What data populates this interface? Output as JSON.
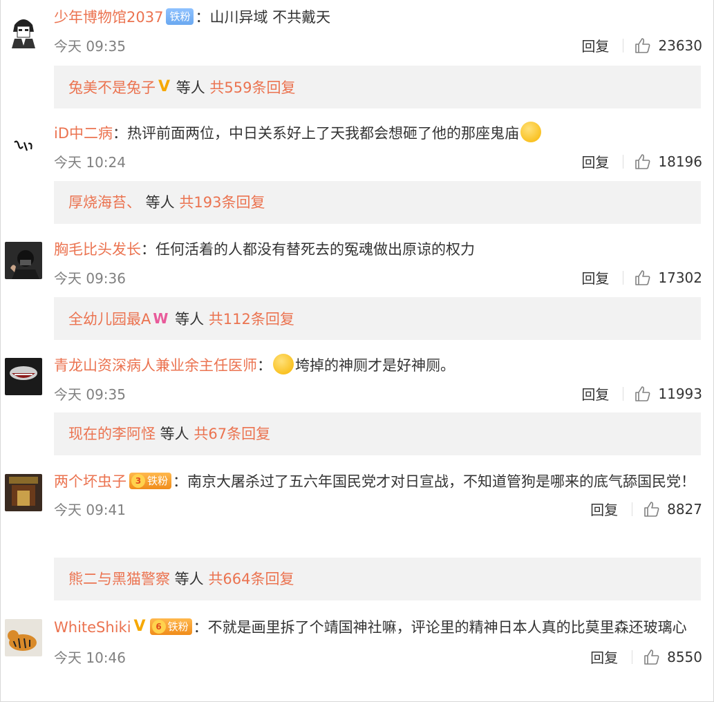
{
  "comments": [
    {
      "username": "少年博物馆2037",
      "badge_text": "铁粉",
      "text": "：山川异域 不共戴天",
      "time": "今天 09:35",
      "reply_label": "回复",
      "likes": "23630",
      "sub_user": "兔美不是兔子",
      "sub_mid": " 等人 ",
      "sub_count": "共559条回复"
    },
    {
      "username": "iD中二病",
      "text": "：热评前面两位，中日关系好上了天我都会想砸了他的那座鬼庙",
      "time": "今天 10:24",
      "reply_label": "回复",
      "likes": "18196",
      "sub_user": "厚烧海苔、",
      "sub_mid": " 等人 ",
      "sub_count": "共193条回复"
    },
    {
      "username": "胸毛比头发长",
      "text": "：任何活着的人都没有替死去的冤魂做出原谅的权力",
      "time": "今天 09:36",
      "reply_label": "回复",
      "likes": "17302",
      "sub_user": "全幼儿园最A",
      "sub_mid": " 等人 ",
      "sub_count": "共112条回复"
    },
    {
      "username": "青龙山资深病人兼业余主任医师",
      "text_pre": "：",
      "text": "垮掉的神厕才是好神厕。",
      "time": "今天 09:35",
      "reply_label": "回复",
      "likes": "11993",
      "sub_user": "现在的李阿怪",
      "sub_mid": " 等人 ",
      "sub_count": "共67条回复"
    },
    {
      "username": "两个坏虫子",
      "badge_level": "3",
      "badge_text": "铁粉",
      "text": "：南京大屠杀过了五六年国民党才对日宣战，不知道管狗是哪来的底气舔国民党！",
      "time": "今天 09:41",
      "reply_label": "回复",
      "likes": "8827",
      "sub_user": "熊二与黑猫警察",
      "sub_mid": " 等人 ",
      "sub_count": "共664条回复"
    },
    {
      "username": "WhiteShiki",
      "badge_level": "6",
      "badge_text": "铁粉",
      "text": "：不就是画里拆了个靖国神社嘛，评论里的精神日本人真的比莫里森还玻璃心",
      "time": "今天 10:46",
      "reply_label": "回复",
      "likes": "8550"
    }
  ],
  "colors": {
    "username": "#eb7350",
    "meta": "#808080",
    "sub_bg": "#f2f2f2"
  }
}
